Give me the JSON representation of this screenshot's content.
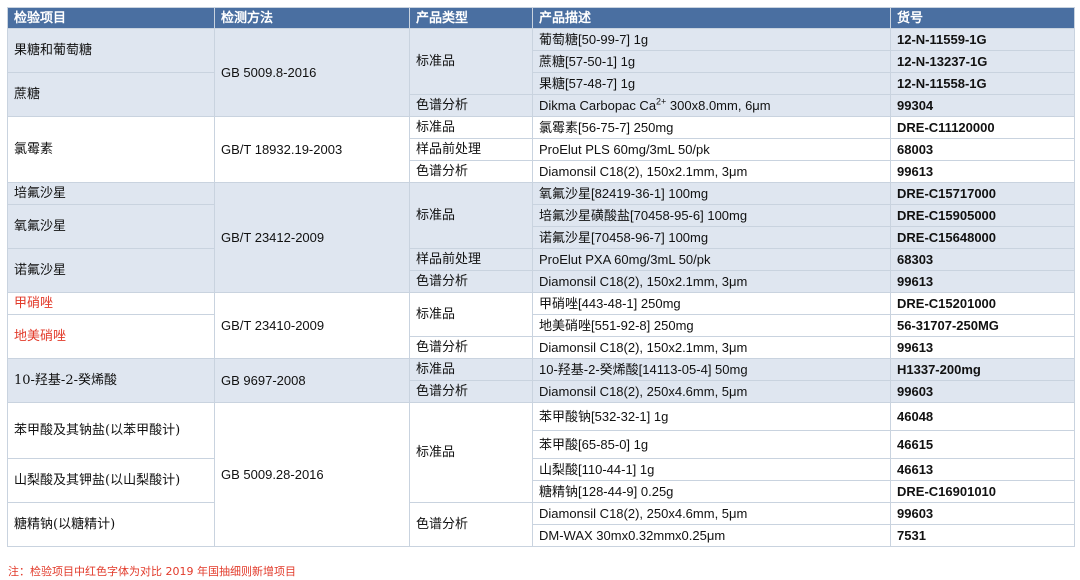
{
  "headers": [
    "检验项目",
    "检测方法",
    "产品类型",
    "产品描述",
    "货号"
  ],
  "rows": [
    {
      "h": 22,
      "s": 1,
      "cells": [
        {
          "k": "item",
          "t": "果糖和葡萄糖",
          "rs": 2
        },
        {
          "k": "method",
          "t": "GB 5009.8-2016",
          "rs": 4
        },
        {
          "k": "type",
          "t": "标准品",
          "rs": 3
        },
        {
          "k": "desc",
          "t": "葡萄糖[50-99-7] 1g"
        },
        {
          "k": "code",
          "t": "12-N-11559-1G"
        }
      ]
    },
    {
      "h": 22,
      "s": 1,
      "cells": [
        {
          "k": "desc",
          "t": "蔗糖[57-50-1] 1g"
        },
        {
          "k": "code",
          "t": "12-N-13237-1G"
        }
      ]
    },
    {
      "h": 22,
      "s": 1,
      "cells": [
        {
          "k": "item",
          "t": "蔗糖",
          "rs": 2
        },
        {
          "k": "desc",
          "t": "果糖[57-48-7] 1g"
        },
        {
          "k": "code",
          "t": "12-N-11558-1G"
        }
      ]
    },
    {
      "h": 22,
      "s": 1,
      "cells": [
        {
          "k": "type",
          "t": "色谱分析"
        },
        {
          "k": "desc",
          "t": "Dikma Carbopac Ca",
          "sup": "2+",
          "t2": " 300x8.0mm, 6μm"
        },
        {
          "k": "code",
          "t": "99304"
        }
      ]
    },
    {
      "h": 22,
      "s": 0,
      "cells": [
        {
          "k": "item",
          "t": "氯霉素",
          "rs": 3
        },
        {
          "k": "method",
          "t": "GB/T 18932.19-2003",
          "rs": 3
        },
        {
          "k": "type",
          "t": "标准品"
        },
        {
          "k": "desc",
          "t": "氯霉素[56-75-7] 250mg"
        },
        {
          "k": "code",
          "t": "DRE-C11120000"
        }
      ]
    },
    {
      "h": 22,
      "s": 0,
      "cells": [
        {
          "k": "type",
          "t": "样品前处理"
        },
        {
          "k": "desc",
          "t": "ProElut PLS 60mg/3mL 50/pk"
        },
        {
          "k": "code",
          "t": "68003"
        }
      ]
    },
    {
      "h": 22,
      "s": 0,
      "cells": [
        {
          "k": "type",
          "t": "色谱分析"
        },
        {
          "k": "desc",
          "t": "Diamonsil C18(2), 150x2.1mm, 3μm"
        },
        {
          "k": "code",
          "t": "99613"
        }
      ]
    },
    {
      "h": 22,
      "s": 1,
      "cells": [
        {
          "k": "item",
          "t": "培氟沙星"
        },
        {
          "k": "method",
          "t": "GB/T 23412-2009",
          "rs": 5
        },
        {
          "k": "type",
          "t": "标准品",
          "rs": 3
        },
        {
          "k": "desc",
          "t": "氧氟沙星[82419-36-1] 100mg"
        },
        {
          "k": "code",
          "t": "DRE-C15717000"
        }
      ]
    },
    {
      "h": 22,
      "s": 1,
      "cells": [
        {
          "k": "item",
          "t": "氧氟沙星",
          "rs": 2
        },
        {
          "k": "desc",
          "t": "培氟沙星磺酸盐[70458-95-6] 100mg"
        },
        {
          "k": "code",
          "t": "DRE-C15905000"
        }
      ]
    },
    {
      "h": 22,
      "s": 1,
      "cells": [
        {
          "k": "desc",
          "t": "诺氟沙星[70458-96-7] 100mg"
        },
        {
          "k": "code",
          "t": "DRE-C15648000"
        }
      ]
    },
    {
      "h": 22,
      "s": 1,
      "cells": [
        {
          "k": "item",
          "t": "诺氟沙星",
          "rs": 2
        },
        {
          "k": "type",
          "t": "样品前处理"
        },
        {
          "k": "desc",
          "t": "ProElut PXA 60mg/3mL 50/pk"
        },
        {
          "k": "code",
          "t": "68303"
        }
      ]
    },
    {
      "h": 22,
      "s": 1,
      "cells": [
        {
          "k": "type",
          "t": "色谱分析"
        },
        {
          "k": "desc",
          "t": "Diamonsil C18(2), 150x2.1mm, 3μm"
        },
        {
          "k": "code",
          "t": "99613"
        }
      ]
    },
    {
      "h": 22,
      "s": 0,
      "cells": [
        {
          "k": "item",
          "t": "甲硝唑",
          "red": true
        },
        {
          "k": "method",
          "t": "GB/T 23410-2009",
          "rs": 3
        },
        {
          "k": "type",
          "t": "标准品",
          "rs": 2
        },
        {
          "k": "desc",
          "t": "甲硝唑[443-48-1] 250mg"
        },
        {
          "k": "code",
          "t": "DRE-C15201000"
        }
      ]
    },
    {
      "h": 22,
      "s": 0,
      "cells": [
        {
          "k": "item",
          "t": "地美硝唑",
          "rs": 2,
          "red": true
        },
        {
          "k": "desc",
          "t": "地美硝唑[551-92-8] 250mg"
        },
        {
          "k": "code",
          "t": "56-31707-250MG"
        }
      ]
    },
    {
      "h": 22,
      "s": 0,
      "cells": [
        {
          "k": "type",
          "t": "色谱分析"
        },
        {
          "k": "desc",
          "t": "Diamonsil C18(2), 150x2.1mm, 3μm"
        },
        {
          "k": "code",
          "t": "99613"
        }
      ]
    },
    {
      "h": 22,
      "s": 1,
      "cells": [
        {
          "k": "item",
          "t": "10-羟基-2-癸烯酸",
          "rs": 2
        },
        {
          "k": "method",
          "t": "GB 9697-2008",
          "rs": 2
        },
        {
          "k": "type",
          "t": "标准品"
        },
        {
          "k": "desc",
          "t": "10-羟基-2-癸烯酸[14113-05-4] 50mg"
        },
        {
          "k": "code",
          "t": "H1337-200mg"
        }
      ]
    },
    {
      "h": 22,
      "s": 1,
      "cells": [
        {
          "k": "type",
          "t": "色谱分析"
        },
        {
          "k": "desc",
          "t": "Diamonsil C18(2), 250x4.6mm, 5μm"
        },
        {
          "k": "code",
          "t": "99603"
        }
      ]
    },
    {
      "h": 28,
      "s": 0,
      "cells": [
        {
          "k": "item",
          "t": "苯甲酸及其钠盐(以苯甲酸计)",
          "rs": 2
        },
        {
          "k": "method",
          "t": "GB 5009.28-2016",
          "rs": 6
        },
        {
          "k": "type",
          "t": "标准品",
          "rs": 4
        },
        {
          "k": "desc",
          "t": "苯甲酸钠[532-32-1] 1g"
        },
        {
          "k": "code",
          "t": "46048"
        }
      ]
    },
    {
      "h": 28,
      "s": 0,
      "cells": [
        {
          "k": "desc",
          "t": "苯甲酸[65-85-0] 1g"
        },
        {
          "k": "code",
          "t": "46615"
        }
      ]
    },
    {
      "h": 22,
      "s": 0,
      "cells": [
        {
          "k": "item",
          "t": "山梨酸及其钾盐(以山梨酸计)",
          "rs": 2
        },
        {
          "k": "desc",
          "t": "山梨酸[110-44-1] 1g"
        },
        {
          "k": "code",
          "t": "46613"
        }
      ]
    },
    {
      "h": 22,
      "s": 0,
      "cells": [
        {
          "k": "desc",
          "t": "糖精钠[128-44-9] 0.25g"
        },
        {
          "k": "code",
          "t": "DRE-C16901010"
        }
      ]
    },
    {
      "h": 22,
      "s": 0,
      "cells": [
        {
          "k": "item",
          "t": "糖精钠(以糖精计)",
          "rs": 2
        },
        {
          "k": "type",
          "t": "色谱分析",
          "rs": 2
        },
        {
          "k": "desc",
          "t": "Diamonsil C18(2), 250x4.6mm, 5μm"
        },
        {
          "k": "code",
          "t": "99603"
        }
      ]
    },
    {
      "h": 22,
      "s": 0,
      "cells": [
        {
          "k": "desc",
          "t": "DM-WAX 30mx0.32mmx0.25μm"
        },
        {
          "k": "code",
          "t": "7531"
        }
      ]
    }
  ],
  "note": "注：检验项目中红色字体为对比 2019 年国抽细则新增项目",
  "colors": {
    "header": "#4a6fa1",
    "stripe": "#dfe6f0",
    "red": "#e23a2a"
  }
}
